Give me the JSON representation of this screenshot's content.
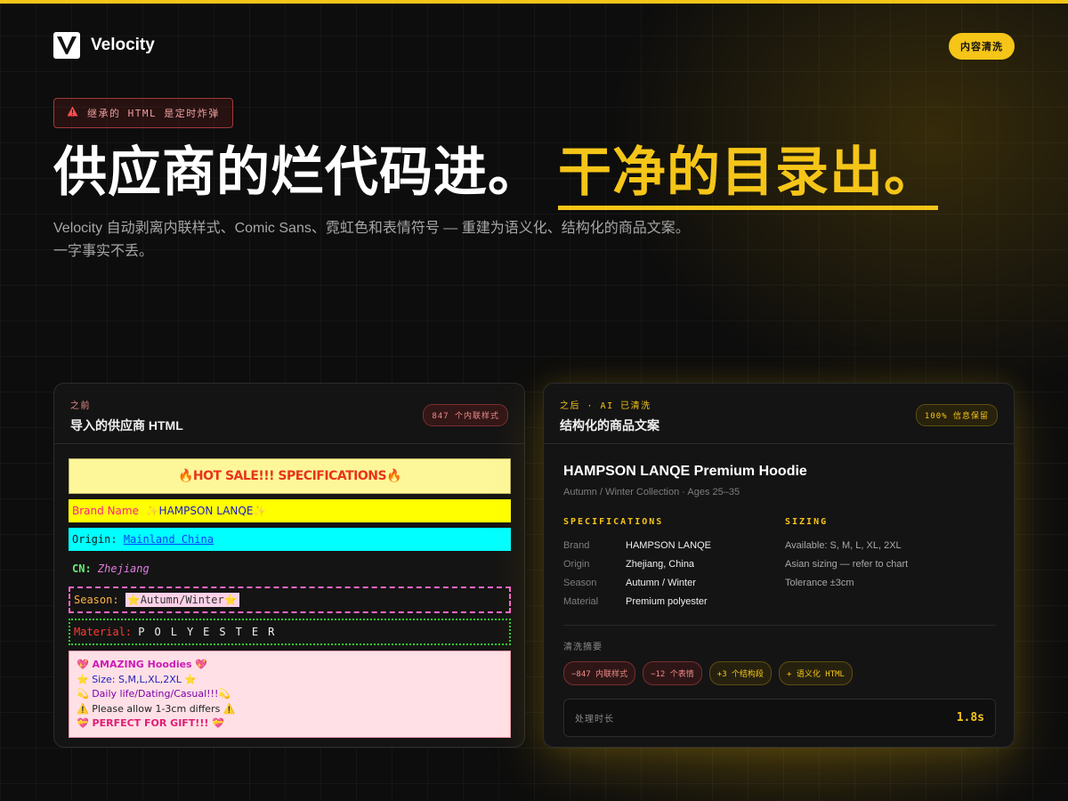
{
  "colors": {
    "accent": "#f5c518",
    "background": "#0d0d0d",
    "danger": "#a13a3a"
  },
  "header": {
    "brand": "Velocity",
    "logo_icon": "velocity-v-logo",
    "pill": "内容清洗"
  },
  "hero": {
    "warning_icon": "warning-triangle-icon",
    "warning": "继承的 HTML 是定时炸弹",
    "title_main": "供应商的烂代码进。",
    "title_accent": "干净的目录出。",
    "subtitle": "Velocity 自动剥离内联样式、Comic Sans、霓虹色和表情符号 — 重建为语义化、结构化的商品文案。一字事实不丢。"
  },
  "before": {
    "kicker": "之前",
    "title": "导入的供应商 HTML",
    "badge": "847 个内联样式",
    "hot_sale": "🔥HOT SALE!!! SPECIFICATIONS🔥",
    "brand_key": "Brand Name",
    "brand_value": "✨HAMPSON LANQE✨",
    "origin_key": "Origin:",
    "origin_value": "Mainland China",
    "cn_key": "CN:",
    "cn_value": "Zhejiang",
    "season_key": "Season:",
    "season_value": "⭐Autumn/Winter⭐",
    "material_key": "Material:",
    "material_value": "POLYESTER",
    "promo_lines": [
      "💖 AMAZING Hoodies 💖",
      "⭐ Size: S,M,L,XL,2XL ⭐",
      "💫 Daily life/Dating/Casual!!!💫",
      "⚠️ Please allow 1-3cm differs ⚠️",
      "💝 PERFECT FOR GIFT!!! 💝"
    ]
  },
  "after": {
    "kicker": "之后 · AI 已清洗",
    "title": "结构化的商品文案",
    "badge": "100% 信息保留",
    "product_title": "HAMPSON LANQE Premium Hoodie",
    "product_sub": "Autumn / Winter Collection · Ages 25–35",
    "spec_heading": "SPECIFICATIONS",
    "specs": [
      {
        "k": "Brand",
        "v": "HAMPSON LANQE"
      },
      {
        "k": "Origin",
        "v": "Zhejiang, China"
      },
      {
        "k": "Season",
        "v": "Autumn / Winter"
      },
      {
        "k": "Material",
        "v": "Premium polyester"
      }
    ],
    "sizing_heading": "SIZING",
    "sizing": [
      "Available: S, M, L, XL, 2XL",
      "Asian sizing — refer to chart",
      "Tolerance ±3cm"
    ],
    "summary_label": "清洗摘要",
    "chips": [
      "−847 内联样式",
      "−12 个表情",
      "+3 个结构段",
      "+ 语义化 HTML"
    ],
    "time_label": "处理时长",
    "time_value": "1.8s"
  }
}
